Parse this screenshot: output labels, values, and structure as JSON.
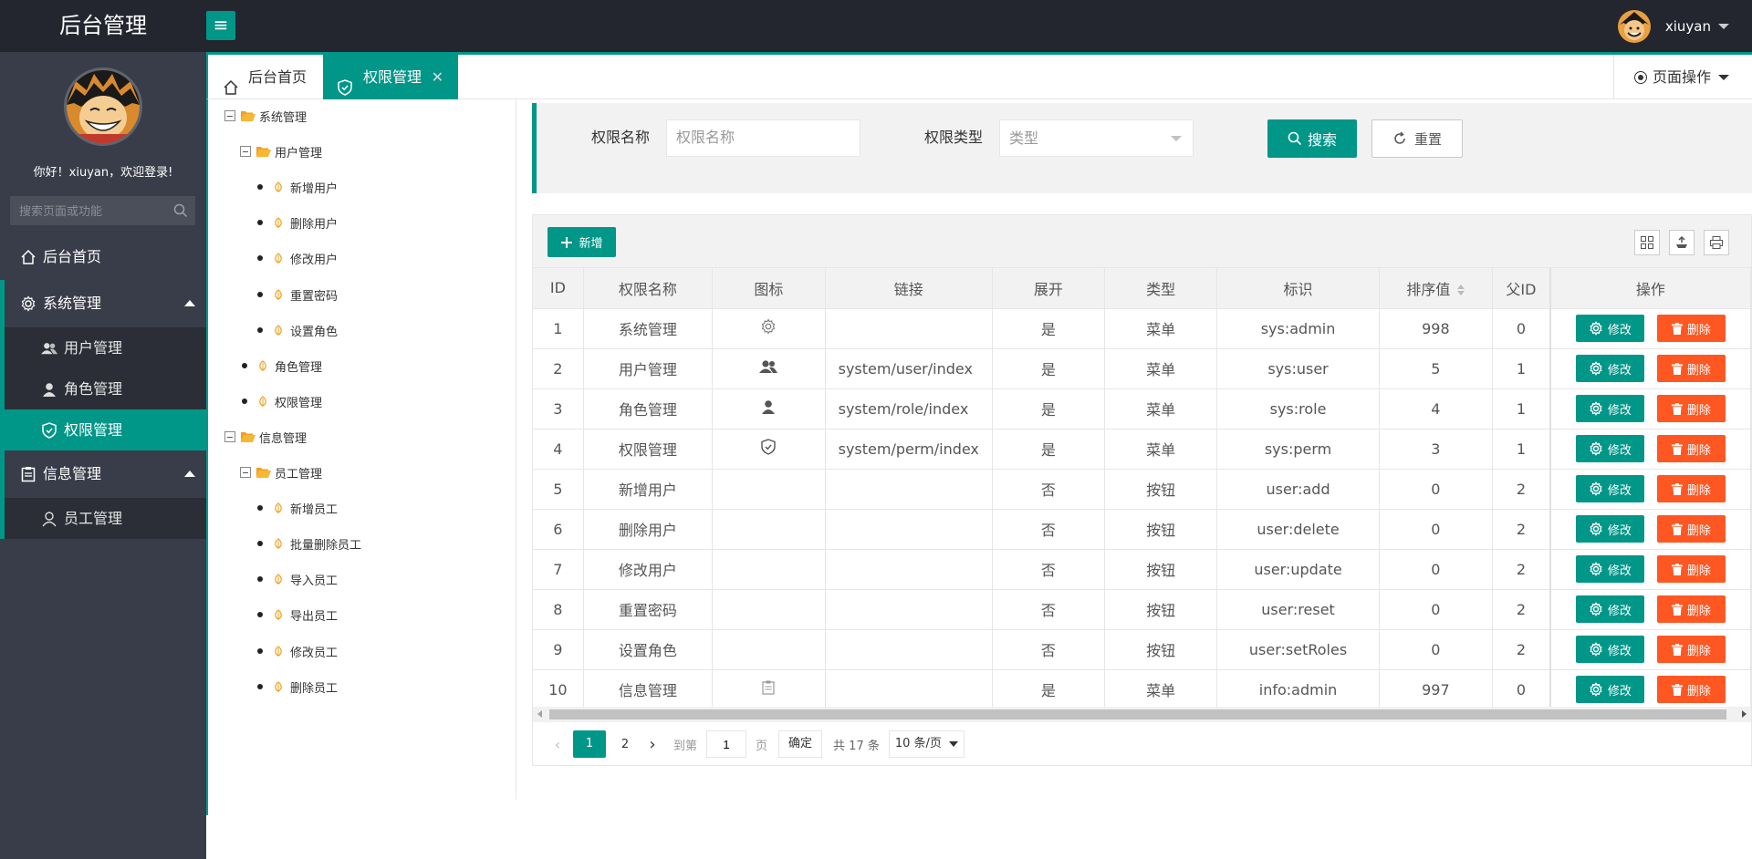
{
  "app": {
    "title": "后台管理"
  },
  "header": {
    "username": "xiuyan"
  },
  "sidebar": {
    "welcome": "你好！xiuyan，欢迎登录!",
    "search_placeholder": "搜索页面或功能",
    "home": "后台首页",
    "groups": [
      {
        "label": "系统管理",
        "items": [
          "用户管理",
          "角色管理",
          "权限管理"
        ]
      },
      {
        "label": "信息管理",
        "items": [
          "员工管理"
        ]
      }
    ]
  },
  "tabs": {
    "home": "后台首页",
    "active": "权限管理",
    "page_ops": "页面操作"
  },
  "tree": {
    "nodes": [
      {
        "label": "系统管理",
        "kind": "folder"
      },
      {
        "label": "用户管理",
        "kind": "folder"
      },
      {
        "label": "新增用户",
        "kind": "leaf"
      },
      {
        "label": "删除用户",
        "kind": "leaf"
      },
      {
        "label": "修改用户",
        "kind": "leaf"
      },
      {
        "label": "重置密码",
        "kind": "leaf"
      },
      {
        "label": "设置角色",
        "kind": "leaf"
      },
      {
        "label": "角色管理",
        "kind": "leaf"
      },
      {
        "label": "权限管理",
        "kind": "leaf"
      },
      {
        "label": "信息管理",
        "kind": "folder"
      },
      {
        "label": "员工管理",
        "kind": "folder"
      },
      {
        "label": "新增员工",
        "kind": "leaf"
      },
      {
        "label": "批量删除员工",
        "kind": "leaf"
      },
      {
        "label": "导入员工",
        "kind": "leaf"
      },
      {
        "label": "导出员工",
        "kind": "leaf"
      },
      {
        "label": "修改员工",
        "kind": "leaf"
      },
      {
        "label": "删除员工",
        "kind": "leaf"
      }
    ]
  },
  "search": {
    "name_label": "权限名称",
    "name_placeholder": "权限名称",
    "type_label": "权限类型",
    "type_placeholder": "类型",
    "search_btn": "搜索",
    "reset_btn": "重置"
  },
  "table": {
    "add_btn": "新增",
    "columns": [
      "ID",
      "权限名称",
      "图标",
      "链接",
      "展开",
      "类型",
      "标识",
      "排序值",
      "父ID",
      "操作"
    ],
    "edit_label": "修改",
    "delete_label": "删除",
    "rows": [
      {
        "id": "1",
        "name": "系统管理",
        "icon": "gear-icon",
        "link": "",
        "expand": "是",
        "type": "菜单",
        "perm": "sys:admin",
        "sort": "998",
        "pid": "0"
      },
      {
        "id": "2",
        "name": "用户管理",
        "icon": "users-icon",
        "link": "system/user/index",
        "expand": "是",
        "type": "菜单",
        "perm": "sys:user",
        "sort": "5",
        "pid": "1"
      },
      {
        "id": "3",
        "name": "角色管理",
        "icon": "user-icon",
        "link": "system/role/index",
        "expand": "是",
        "type": "菜单",
        "perm": "sys:role",
        "sort": "4",
        "pid": "1"
      },
      {
        "id": "4",
        "name": "权限管理",
        "icon": "shield-icon",
        "link": "system/perm/index",
        "expand": "是",
        "type": "菜单",
        "perm": "sys:perm",
        "sort": "3",
        "pid": "1"
      },
      {
        "id": "5",
        "name": "新增用户",
        "icon": "",
        "link": "",
        "expand": "否",
        "type": "按钮",
        "perm": "user:add",
        "sort": "0",
        "pid": "2"
      },
      {
        "id": "6",
        "name": "删除用户",
        "icon": "",
        "link": "",
        "expand": "否",
        "type": "按钮",
        "perm": "user:delete",
        "sort": "0",
        "pid": "2"
      },
      {
        "id": "7",
        "name": "修改用户",
        "icon": "",
        "link": "",
        "expand": "否",
        "type": "按钮",
        "perm": "user:update",
        "sort": "0",
        "pid": "2"
      },
      {
        "id": "8",
        "name": "重置密码",
        "icon": "",
        "link": "",
        "expand": "否",
        "type": "按钮",
        "perm": "user:reset",
        "sort": "0",
        "pid": "2"
      },
      {
        "id": "9",
        "name": "设置角色",
        "icon": "",
        "link": "",
        "expand": "否",
        "type": "按钮",
        "perm": "user:setRoles",
        "sort": "0",
        "pid": "2"
      },
      {
        "id": "10",
        "name": "信息管理",
        "icon": "clipboard-icon",
        "link": "",
        "expand": "是",
        "type": "菜单",
        "perm": "info:admin",
        "sort": "997",
        "pid": "0"
      }
    ]
  },
  "pager": {
    "current": "1",
    "next_page": "2",
    "goto_label": "到第",
    "goto_value": "1",
    "page_unit": "页",
    "confirm": "确定",
    "total": "共 17 条",
    "page_size": "10 条/页"
  },
  "colors": {
    "accent": "#009688",
    "danger": "#ff5722",
    "header": "#23262e",
    "sidebar": "#393d49"
  }
}
